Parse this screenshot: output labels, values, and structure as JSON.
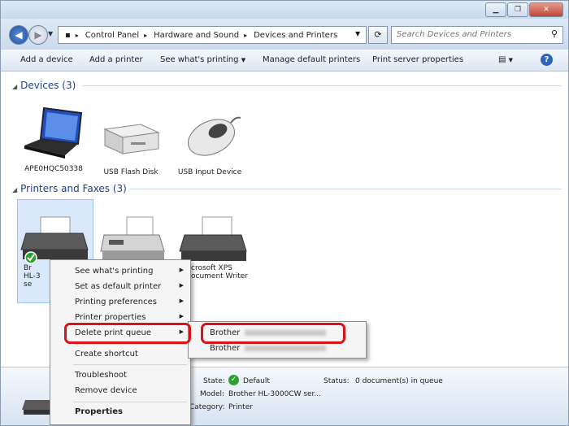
{
  "breadcrumb": [
    "Control Panel",
    "Hardware and Sound",
    "Devices and Printers"
  ],
  "search": {
    "placeholder": "Search Devices and Printers"
  },
  "toolbar": {
    "add_device": "Add a device",
    "add_printer": "Add a printer",
    "see_printing": "See what's printing",
    "manage_default": "Manage default printers",
    "print_server": "Print server properties"
  },
  "groups": {
    "devices": "Devices (3)",
    "printers": "Printers and Faxes (3)"
  },
  "devices": [
    "APE0HQC50338",
    "USB Flash Disk",
    "USB Input Device"
  ],
  "printers": {
    "p1_label_lines": [
      "Br",
      "HL-3",
      "se"
    ],
    "p3_label_lines": [
      "crosoft XPS",
      "ocument Writer"
    ]
  },
  "context_menu": {
    "see_printing": "See what's printing",
    "set_default": "Set as default printer",
    "preferences": "Printing preferences",
    "printer_properties": "Printer properties",
    "delete_queue": "Delete print queue",
    "create_shortcut": "Create shortcut",
    "troubleshoot": "Troubleshoot",
    "remove_device": "Remove device",
    "properties": "Properties"
  },
  "submenu": {
    "item1": "Brother",
    "item2": "Brother"
  },
  "details": {
    "state_label": "State:",
    "state_value": "Default",
    "status_label": "Status:",
    "status_value": "0 document(s) in queue",
    "model_label": "Model:",
    "model_value": "Brother HL-3000CW ser...",
    "category_label": "Category:",
    "category_value": "Printer"
  },
  "colors": {
    "highlight_box": "#d7141a",
    "selection": "#d9e8fb",
    "group_text": "#1e3f8a"
  }
}
